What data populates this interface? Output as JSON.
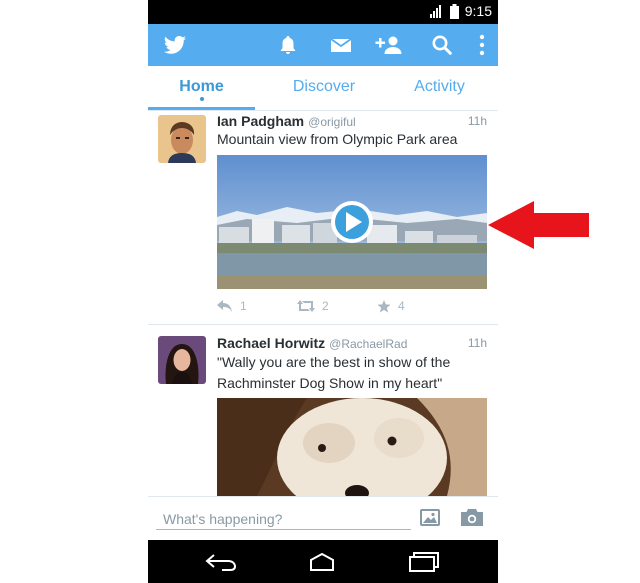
{
  "status_bar": {
    "time": "9:15"
  },
  "tabs": [
    {
      "label": "Home",
      "active": true
    },
    {
      "label": "Discover",
      "active": false
    },
    {
      "label": "Activity",
      "active": false
    }
  ],
  "tweets": [
    {
      "name": "Ian Padgham",
      "handle": "@origiful",
      "time": "11h",
      "text": "Mountain view from Olympic Park area",
      "media": "video",
      "replies": "1",
      "retweets": "2",
      "favorites": "4"
    },
    {
      "name": "Rachael Horwitz",
      "handle": "@RachaelRad",
      "time": "11h",
      "text_line1": "\"Wally you are the best in show of the",
      "text_line2": "Rachminster Dog Show in my heart\"",
      "media": "photo"
    }
  ],
  "compose": {
    "placeholder": "What's happening?"
  },
  "colors": {
    "brand": "#55acee",
    "annotation_arrow": "#e8141b"
  }
}
